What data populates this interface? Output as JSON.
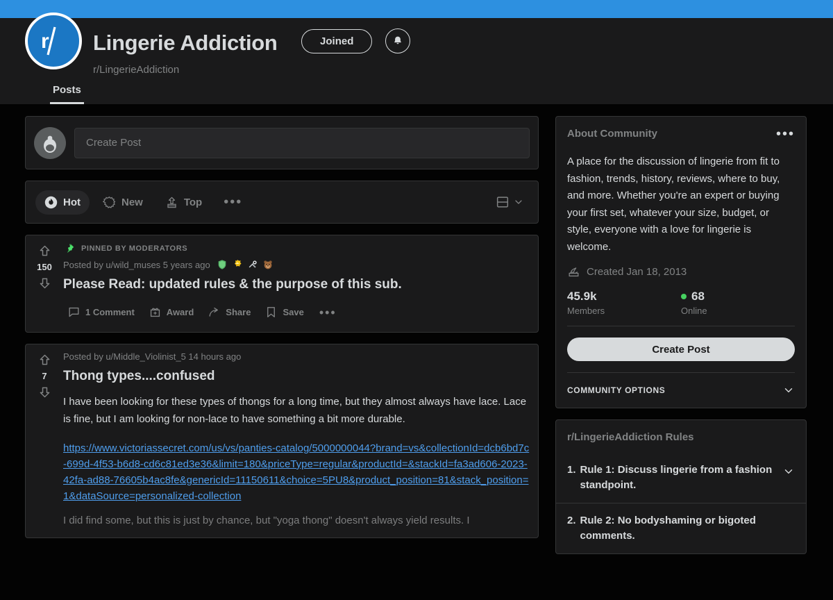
{
  "header": {
    "banner_color": "#2d90e0",
    "icon_text": "r/",
    "community_title": "Lingerie Addiction",
    "community_handle": "r/LingerieAddiction",
    "joined_label": "Joined",
    "bell_icon": "bell-icon",
    "tabs": [
      {
        "label": "Posts",
        "active": true
      }
    ]
  },
  "create_post": {
    "placeholder": "Create Post",
    "avatar_icon": "snoo-avatar-icon"
  },
  "sortbar": {
    "items": [
      {
        "label": "Hot",
        "icon": "flame-icon",
        "active": true
      },
      {
        "label": "New",
        "icon": "starburst-icon",
        "active": false
      },
      {
        "label": "Top",
        "icon": "podium-arrow-icon",
        "active": false
      }
    ],
    "more_label": "•••",
    "layout_icon": "card-view-icon",
    "layout_chevron": "chevron-down-icon"
  },
  "posts": [
    {
      "id": "pinned-post",
      "pinned_label": "PINNED BY MODERATORS",
      "pin_icon": "pushpin-icon",
      "score": "150",
      "meta": "Posted by u/wild_muses 5 years ago",
      "flairs": [
        "shield-award-icon",
        "gold-crown-award-icon",
        "silver-tools-award-icon",
        "bear-award-icon"
      ],
      "title": "Please Read: updated rules & the purpose of this sub.",
      "actions": [
        {
          "label": "1 Comment",
          "icon": "comment-icon"
        },
        {
          "label": "Award",
          "icon": "gift-icon"
        },
        {
          "label": "Share",
          "icon": "share-arrow-icon"
        },
        {
          "label": "Save",
          "icon": "bookmark-icon"
        }
      ],
      "more_label": "•••"
    },
    {
      "id": "thong-types-post",
      "score": "7",
      "meta": "Posted by u/Middle_Violinist_5 14 hours ago",
      "title": "Thong types....confused",
      "body": "I have been looking for these types of thongs for a long time, but they almost always have lace. Lace is fine, but I am looking for non-lace to have something a bit more durable.",
      "link": "https://www.victoriassecret.com/us/vs/panties-catalog/5000000044?brand=vs&collectionId=dcb6bd7c-699d-4f53-b6d8-cd6c81ed3e36&limit=180&priceType=regular&productId=&stackId=fa3ad606-2023-42fa-ad88-76605b4ac8fe&genericId=11150611&choice=5PU8&product_position=81&stack_position=1&dataSource=personalized-collection",
      "body2": "I did find some, but this is just by chance, but \"yoga thong\" doesn't always yield results. I"
    }
  ],
  "sidebar": {
    "about": {
      "title": "About Community",
      "more_label": "•••",
      "description": "A place for the discussion of lingerie from fit to fashion, trends, history, reviews, where to buy, and more. Whether you're an expert or buying your first set, whatever your size, budget, or style, everyone with a love for lingerie is welcome.",
      "created": "Created Jan 18, 2013",
      "created_icon": "cake-icon",
      "members_value": "45.9k",
      "members_label": "Members",
      "online_value": "68",
      "online_label": "Online",
      "online_dot_color": "#46d160",
      "create_post_label": "Create Post",
      "community_options_label": "COMMUNITY OPTIONS",
      "community_options_chevron": "chevron-down-icon"
    },
    "rules": {
      "title": "r/LingerieAddiction Rules",
      "items": [
        {
          "num": "1.",
          "text": "Rule 1: Discuss lingerie from a fashion standpoint."
        },
        {
          "num": "2.",
          "text": "Rule 2: No bodyshaming or bigoted comments."
        }
      ]
    }
  }
}
